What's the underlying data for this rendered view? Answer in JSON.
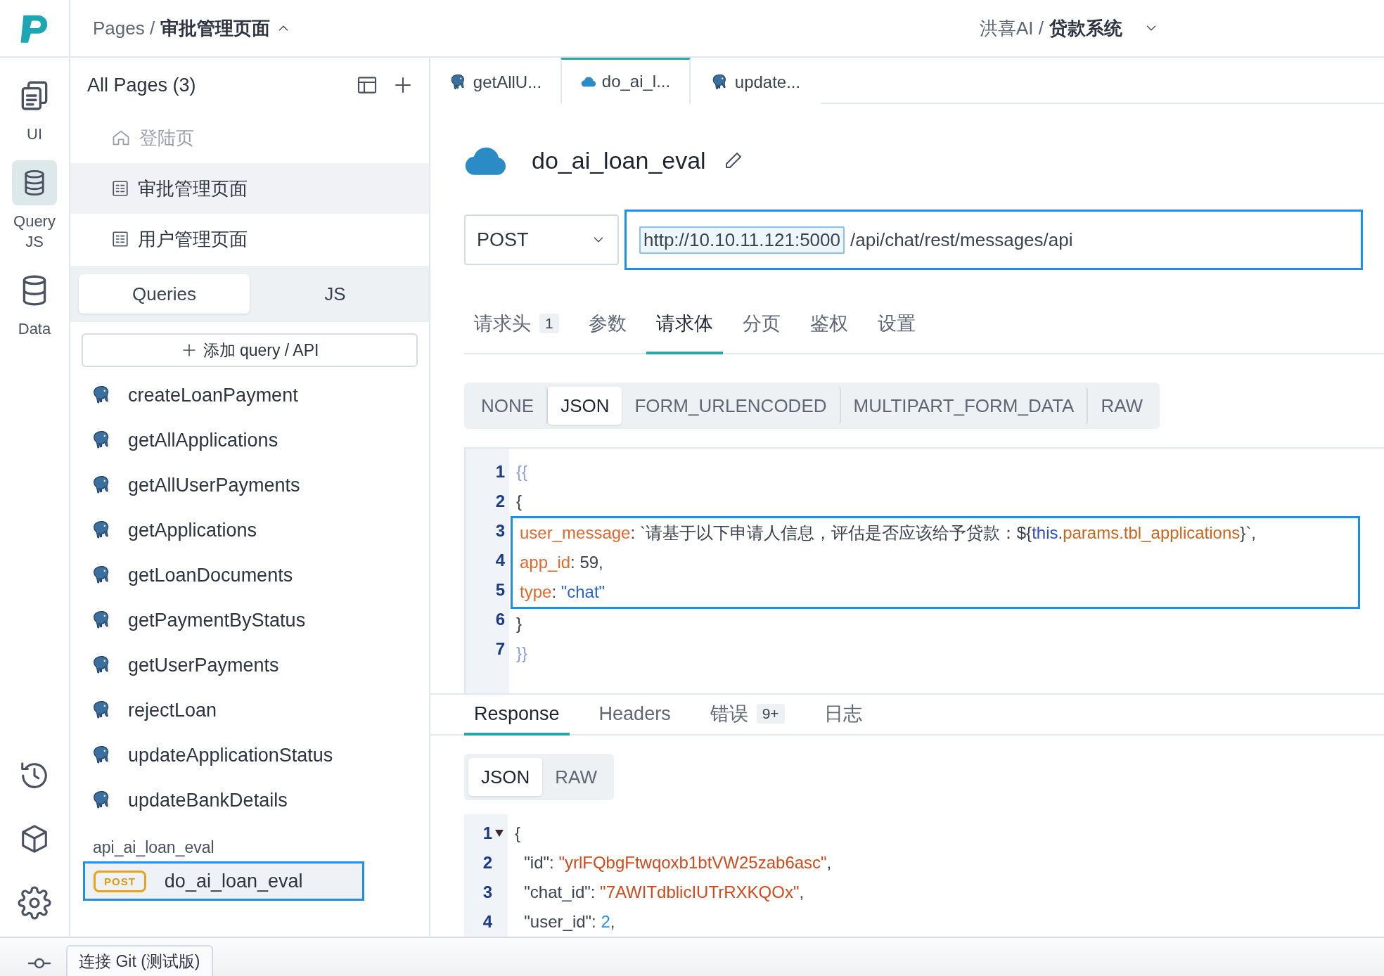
{
  "topbar": {
    "breadcrumb_root": "Pages /",
    "breadcrumb_page": "审批管理页面",
    "workspace": "洪喜AI /",
    "app": "贷款系统"
  },
  "rail": {
    "items": [
      {
        "label": "UI",
        "selected": false
      },
      {
        "label": "Query JS",
        "selected": true
      },
      {
        "label": "Data",
        "selected": false
      }
    ]
  },
  "sidebar": {
    "title": "All Pages (3)",
    "pages": [
      {
        "kind": "home",
        "label": "登陆页",
        "muted": true,
        "selected": false
      },
      {
        "kind": "page",
        "label": "审批管理页面",
        "muted": false,
        "selected": true
      },
      {
        "kind": "page",
        "label": "用户管理页面",
        "muted": false,
        "selected": false
      }
    ],
    "tabs": [
      {
        "label": "Queries",
        "selected": true
      },
      {
        "label": "JS",
        "selected": false
      }
    ],
    "add_button": "添加 query / API",
    "queries": [
      {
        "label": "createLoanPayment"
      },
      {
        "label": "getAllApplications"
      },
      {
        "label": "getAllUserPayments"
      },
      {
        "label": "getApplications"
      },
      {
        "label": "getLoanDocuments"
      },
      {
        "label": "getPaymentByStatus"
      },
      {
        "label": "getUserPayments"
      },
      {
        "label": "rejectLoan"
      },
      {
        "label": "updateApplicationStatus"
      },
      {
        "label": "updateBankDetails"
      }
    ],
    "api_group": {
      "title": "api_ai_loan_eval",
      "items": [
        {
          "method": "POST",
          "label": "do_ai_loan_eval",
          "selected": true
        }
      ]
    }
  },
  "editor_tabs": [
    {
      "kind": "database",
      "label": "getAllU...",
      "selected": false
    },
    {
      "kind": "api",
      "label": "do_ai_l...",
      "selected": true
    },
    {
      "kind": "database",
      "label": "update...",
      "selected": false
    }
  ],
  "query": {
    "name": "do_ai_loan_eval",
    "method": "POST",
    "url_parts": [
      {
        "text": "http://10.10.11.121:5000",
        "highlighted": true
      },
      {
        "text": "/api/chat/rest/messages/api",
        "highlighted": false
      }
    ],
    "tabs": [
      {
        "label": "请求头",
        "badge": "1",
        "selected": false
      },
      {
        "label": "参数",
        "selected": false
      },
      {
        "label": "请求体",
        "selected": true
      },
      {
        "label": "分页",
        "selected": false
      },
      {
        "label": "鉴权",
        "selected": false
      },
      {
        "label": "设置",
        "selected": false
      }
    ],
    "body_types": [
      {
        "label": "NONE",
        "selected": false
      },
      {
        "label": "JSON",
        "selected": true
      },
      {
        "label": "FORM_URLENCODED",
        "selected": false
      },
      {
        "label": "MULTIPART_FORM_DATA",
        "selected": false
      },
      {
        "label": "RAW",
        "selected": false
      }
    ],
    "body_lines": [
      {
        "number": "1",
        "boxed": false,
        "tokens": [
          {
            "kind": "brace",
            "text": "{{"
          }
        ]
      },
      {
        "number": "2",
        "boxed": false,
        "tokens": [
          {
            "kind": "plain",
            "text": "{"
          }
        ]
      },
      {
        "number": "3",
        "boxed": true,
        "tokens": [
          {
            "kind": "key",
            "text": "user_message"
          },
          {
            "kind": "plain",
            "text": ": `请基于以下申请人信息，评估是否应该给予贷款：${"
          },
          {
            "kind": "keyword",
            "text": "this"
          },
          {
            "kind": "plain",
            "text": "."
          },
          {
            "kind": "property",
            "text": "params.tbl_applications"
          },
          {
            "kind": "plain",
            "text": "}`,"
          }
        ]
      },
      {
        "number": "4",
        "boxed": true,
        "tokens": [
          {
            "kind": "key",
            "text": "app_id"
          },
          {
            "kind": "plain",
            "text": ": 59,"
          }
        ]
      },
      {
        "number": "5",
        "boxed": true,
        "tokens": [
          {
            "kind": "key",
            "text": "type"
          },
          {
            "kind": "plain",
            "text": ": "
          },
          {
            "kind": "string",
            "text": "\"chat\""
          }
        ]
      },
      {
        "number": "6",
        "boxed": false,
        "tokens": [
          {
            "kind": "plain",
            "text": "}"
          }
        ]
      },
      {
        "number": "7",
        "boxed": false,
        "tokens": [
          {
            "kind": "brace",
            "text": "}}"
          }
        ]
      }
    ]
  },
  "response": {
    "tabs": [
      {
        "label": "Response",
        "selected": true
      },
      {
        "label": "Headers",
        "selected": false
      },
      {
        "label": "错误",
        "badge": "9+",
        "selected": false
      },
      {
        "label": "日志",
        "selected": false
      }
    ],
    "formats": [
      {
        "label": "JSON",
        "selected": true
      },
      {
        "label": "RAW",
        "selected": false
      }
    ],
    "lines": [
      {
        "number": "1",
        "foldable": true,
        "tokens": [
          {
            "kind": "plain",
            "text": "{"
          }
        ]
      },
      {
        "number": "2",
        "foldable": false,
        "tokens": [
          {
            "kind": "plain",
            "text": "  \"id\": "
          },
          {
            "kind": "rstring",
            "text": "\"yrlFQbgFtwqoxb1btVW25zab6asc\""
          },
          {
            "kind": "plain",
            "text": ","
          }
        ]
      },
      {
        "number": "3",
        "foldable": false,
        "tokens": [
          {
            "kind": "plain",
            "text": "  \"chat_id\": "
          },
          {
            "kind": "rstring",
            "text": "\"7AWITdblicIUTrRXKQOx\""
          },
          {
            "kind": "plain",
            "text": ","
          }
        ]
      },
      {
        "number": "4",
        "foldable": false,
        "tokens": [
          {
            "kind": "plain",
            "text": "  \"user_id\": "
          },
          {
            "kind": "number",
            "text": "2"
          },
          {
            "kind": "plain",
            "text": ","
          }
        ]
      }
    ]
  },
  "footer": {
    "git_button": "连接 Git (测试版)"
  }
}
